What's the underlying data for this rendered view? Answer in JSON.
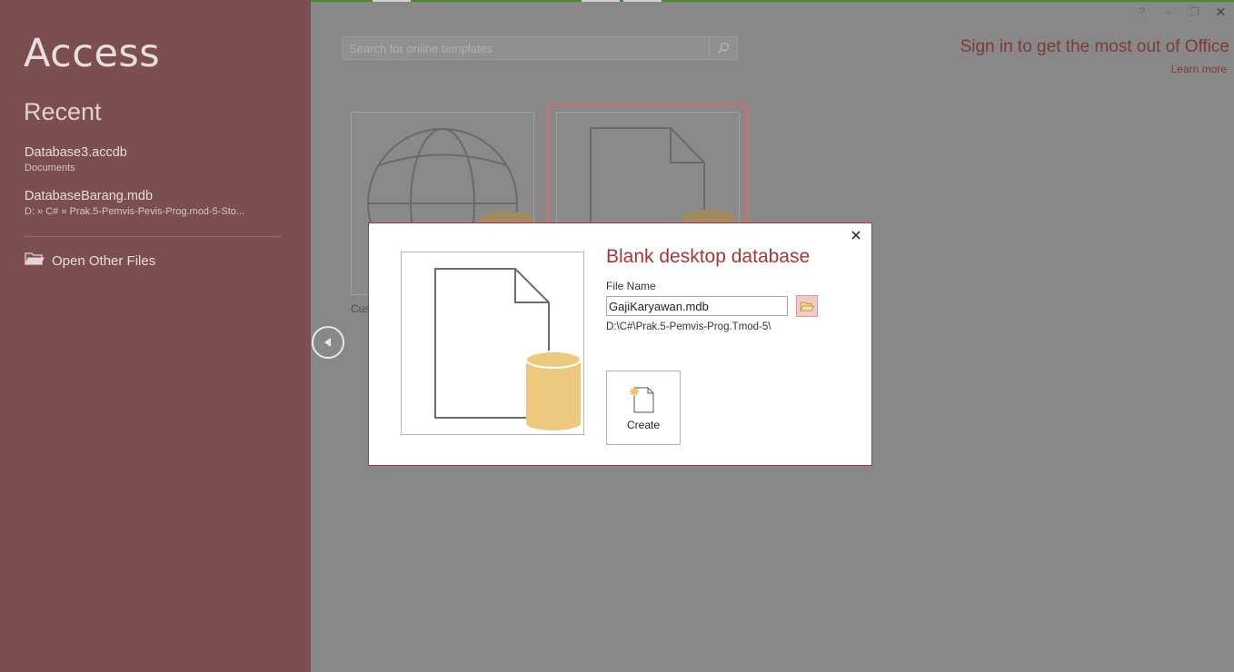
{
  "app": {
    "title": "Access"
  },
  "recent": {
    "heading": "Recent",
    "items": [
      {
        "name": "Database3.accdb",
        "path": "Documents"
      },
      {
        "name": "DatabaseBarang.mdb",
        "path": "D: » C# » Prak.5-Pemvis-Pevis-Prog.mod-5-Sto..."
      }
    ],
    "open_other": "Open Other Files"
  },
  "search": {
    "placeholder": "Search for online templates"
  },
  "account": {
    "signin": "Sign in to get the most out of Office",
    "learn_more": "Learn more"
  },
  "window": {
    "help": "?",
    "minimize": "–",
    "restore": "❐",
    "close": "✕"
  },
  "templates": {
    "partial_label": "Cus"
  },
  "dialog": {
    "title": "Blank desktop database",
    "file_name_label": "File Name",
    "file_name_value": "GajiKaryawan.mdb",
    "path": "D:\\C#\\Prak.5-Pemvis-Prog.Tmod-5\\",
    "create_label": "Create"
  },
  "colors": {
    "accent": "#a4373a",
    "sidebar": "#7b4e50",
    "database": "#edc97e"
  }
}
